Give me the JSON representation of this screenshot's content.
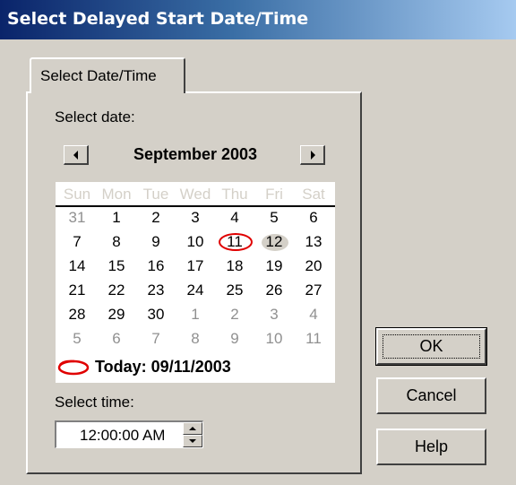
{
  "window": {
    "title": "Select Delayed Start Date/Time"
  },
  "tab": {
    "label": "Select Date/Time"
  },
  "date_section": {
    "label": "Select date:"
  },
  "calendar": {
    "month_label": "September 2003",
    "weekdays": [
      "Sun",
      "Mon",
      "Tue",
      "Wed",
      "Thu",
      "Fri",
      "Sat"
    ],
    "weeks": [
      [
        {
          "d": "31",
          "o": true
        },
        {
          "d": "1"
        },
        {
          "d": "2"
        },
        {
          "d": "3"
        },
        {
          "d": "4"
        },
        {
          "d": "5"
        },
        {
          "d": "6"
        }
      ],
      [
        {
          "d": "7"
        },
        {
          "d": "8"
        },
        {
          "d": "9"
        },
        {
          "d": "10"
        },
        {
          "d": "11",
          "today": true
        },
        {
          "d": "12",
          "selected": true
        },
        {
          "d": "13"
        }
      ],
      [
        {
          "d": "14"
        },
        {
          "d": "15"
        },
        {
          "d": "16"
        },
        {
          "d": "17"
        },
        {
          "d": "18"
        },
        {
          "d": "19"
        },
        {
          "d": "20"
        }
      ],
      [
        {
          "d": "21"
        },
        {
          "d": "22"
        },
        {
          "d": "23"
        },
        {
          "d": "24"
        },
        {
          "d": "25"
        },
        {
          "d": "26"
        },
        {
          "d": "27"
        }
      ],
      [
        {
          "d": "28"
        },
        {
          "d": "29"
        },
        {
          "d": "30"
        },
        {
          "d": "1",
          "o": true
        },
        {
          "d": "2",
          "o": true
        },
        {
          "d": "3",
          "o": true
        },
        {
          "d": "4",
          "o": true
        }
      ],
      [
        {
          "d": "5",
          "o": true
        },
        {
          "d": "6",
          "o": true
        },
        {
          "d": "7",
          "o": true
        },
        {
          "d": "8",
          "o": true
        },
        {
          "d": "9",
          "o": true
        },
        {
          "d": "10",
          "o": true
        },
        {
          "d": "11",
          "o": true
        }
      ]
    ],
    "today_label": "Today: 09/11/2003",
    "colors": {
      "today_circle": "#e00000",
      "selected_bg": "#d4d0c8",
      "other_month": "#909090"
    }
  },
  "time_section": {
    "label": "Select time:",
    "value": "12:00:00 AM"
  },
  "buttons": {
    "ok": "OK",
    "cancel": "Cancel",
    "help": "Help"
  },
  "icons": {
    "prev": "arrow-left-icon",
    "next": "arrow-right-icon",
    "spin_up": "spin-up-icon",
    "spin_down": "spin-down-icon"
  }
}
